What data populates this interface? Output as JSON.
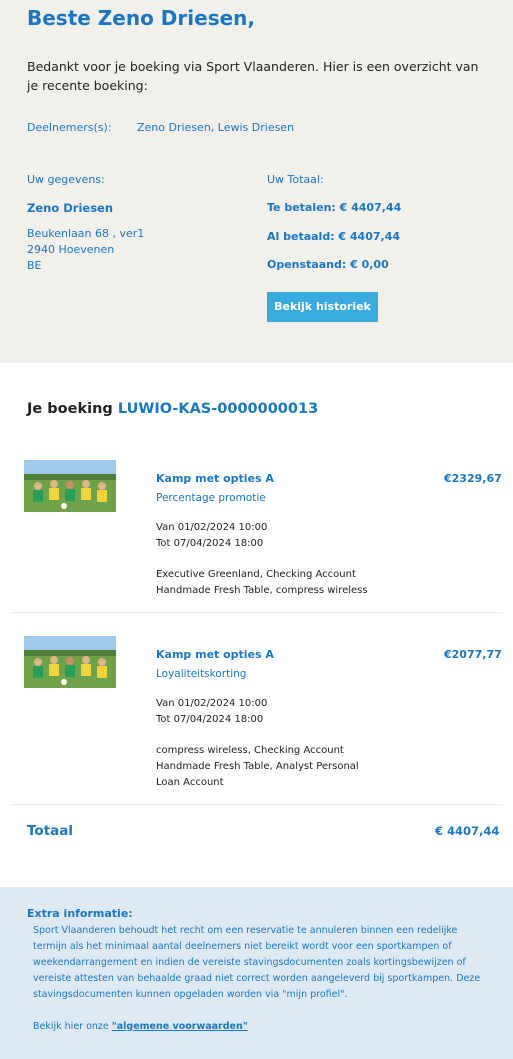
{
  "header": {
    "greeting": "Beste Zeno Driesen,",
    "intro": "Bedankt voor je boeking via Sport Vlaanderen. Hier is een overzicht van je recente boeking:",
    "participants_label": "Deelnemers(s):",
    "participants": "Zeno Driesen, Lewis Driesen"
  },
  "customer": {
    "label": "Uw gegevens:",
    "name": "Zeno Driesen",
    "street": "Beukenlaan 68 , ver1",
    "city": "2940 Hoevenen",
    "country": "BE"
  },
  "totals": {
    "label": "Uw Totaal:",
    "to_pay": "Te betalen: € 4407,44",
    "paid": "Al betaald: € 4407,44",
    "outstanding": "Openstaand: € 0,00",
    "history_button": "Bekijk historiek"
  },
  "booking": {
    "title": "Je boeking",
    "code": "LUWIO-KAS-0000000013",
    "items": [
      {
        "title": "Kamp met opties A",
        "promo": "Percentage promotie",
        "price": "€2329,67",
        "from": "Van 01/02/2024 10:00",
        "to": "Tot 07/04/2024 18:00",
        "options_line1": "Executive Greenland, Checking Account",
        "options_line2": "Handmade Fresh Table, compress wireless",
        "options_line3": ""
      },
      {
        "title": "Kamp met opties A",
        "promo": "Loyaliteitskorting",
        "price": "€2077,77",
        "from": "Van 01/02/2024 10:00",
        "to": "Tot 07/04/2024 18:00",
        "options_line1": "compress wireless, Checking Account",
        "options_line2": "Handmade Fresh Table, Analyst Personal",
        "options_line3": "Loan Account"
      }
    ],
    "total_label": "Totaal",
    "total_value": "€ 4407,44"
  },
  "extra": {
    "title": "Extra informatie:",
    "text": "Sport Vlaanderen behoudt het recht om een reservatie te annuleren binnen een redelijke termijn als het minimaal aantal deelnemers niet bereikt wordt voor een sportkampen of weekendarrangement en indien de vereiste stavingsdocumenten zoals kortingsbewijzen of vereiste attesten van behaalde graad niet correct worden aangeleverd bij sportkampen. Deze stavingsdocumenten kunnen opgeladen worden via \"mijn profiel\".",
    "link_prefix": "Bekijk hier onze",
    "link_text": "\"algemene voorwaarden\""
  },
  "colors": {
    "accent": "#1a77c4",
    "button": "#3aabde",
    "top_bg": "#f1f0eb",
    "extra_bg": "#dde9f3"
  }
}
